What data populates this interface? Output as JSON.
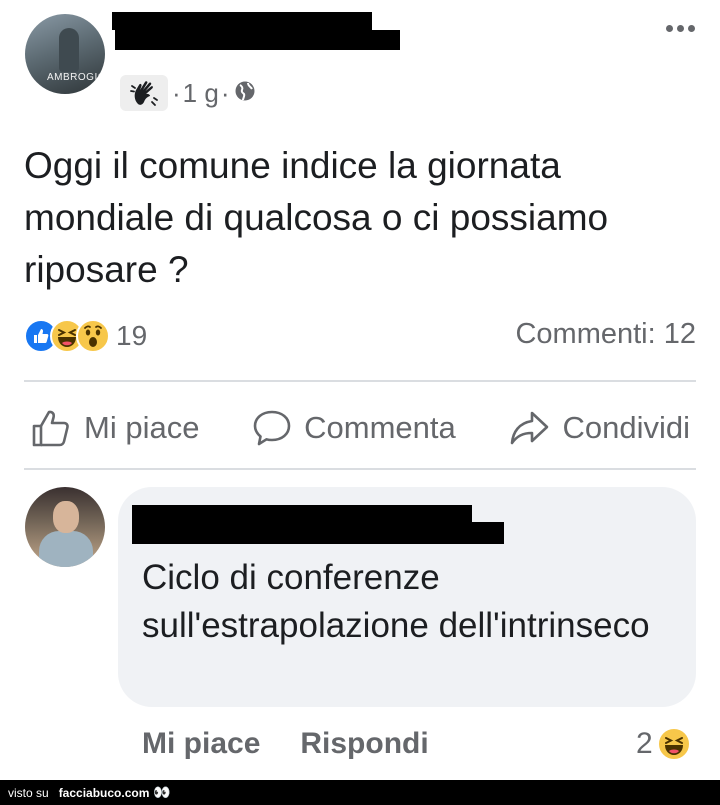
{
  "post": {
    "author_avatar_text": "AMBROGIO",
    "time": "1 g",
    "separator": "·",
    "text": "Oggi il comune indice la giornata mondiale di qualcosa o ci possiamo riposare ?",
    "reaction_count": "19",
    "reaction_icons": [
      "like-icon",
      "haha-icon",
      "wow-icon"
    ],
    "comments_label": "Commenti: 12"
  },
  "actions": {
    "like": "Mi piace",
    "comment": "Commenta",
    "share": "Condividi"
  },
  "comment": {
    "text": "Ciclo di conferenze sull'estrapolazione dell'intrinseco",
    "like": "Mi piace",
    "reply": "Rispondi",
    "reaction_count": "2",
    "reaction_icon": "haha-icon"
  },
  "footer": {
    "prefix": "visto su",
    "site": "facciabuco.com",
    "eyes": "👀"
  },
  "colors": {
    "text": "#1c1e21",
    "secondary": "#65676b",
    "like_blue": "#1877f2",
    "emoji_yellow": "#f7c74a",
    "bubble": "#f0f2f5",
    "divider": "#dadde1"
  }
}
